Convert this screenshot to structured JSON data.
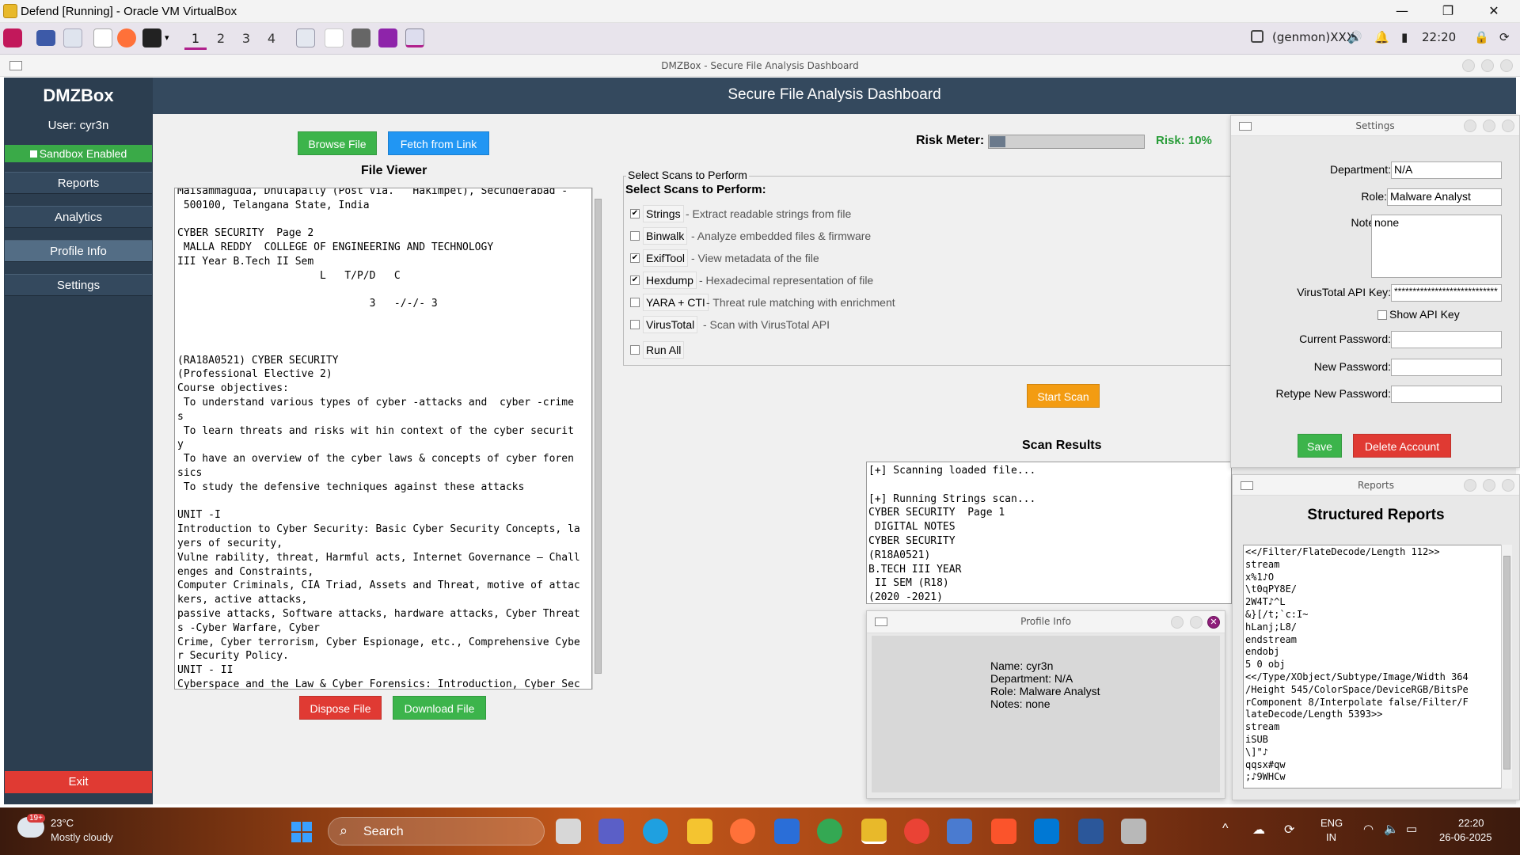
{
  "host": {
    "title": "Defend [Running] - Oracle VM VirtualBox",
    "controls": [
      "—",
      "❐",
      "✕"
    ]
  },
  "panel": {
    "workspaces": [
      "1",
      "2",
      "3",
      "4"
    ],
    "genmon": "(genmon)XXX",
    "clock": "22:20"
  },
  "app": {
    "window_title": "DMZBox - Secure File Analysis Dashboard",
    "sidebar": {
      "brand": "DMZBox",
      "user": "User: cyr3n",
      "sandbox": "Sandbox Enabled",
      "items": [
        {
          "label": "Reports"
        },
        {
          "label": "Analytics"
        },
        {
          "label": "Profile Info"
        },
        {
          "label": "Settings"
        }
      ],
      "exit": "Exit"
    },
    "header_title": "Secure File Analysis Dashboard",
    "toolbar": {
      "browse": "Browse File",
      "fetch": "Fetch from Link",
      "risk_label": "Risk Meter:",
      "risk_value": "Risk: 10%",
      "risk_fraction": 0.1
    },
    "file_viewer": {
      "title": "File Viewer",
      "content": "Maisammaguda, Dhulapally (Post Via.   Hakimpet), Secunderabad -\n 500100, Telangana State, India\n\nCYBER SECURITY  Page 2\n MALLA REDDY  COLLEGE OF ENGINEERING AND TECHNOLOGY\nIII Year B.Tech II Sem\n                       L   T/P/D   C\n\n                               3   -/-/- 3\n\n\n\n(RA18A0521) CYBER SECURITY\n(Professional Elective 2)\nCourse objectives:\n To understand various types of cyber -attacks and  cyber -crime\ns\n To learn threats and risks wit hin context of the cyber securit\ny\n To have an overview of the cyber laws & concepts of cyber foren\nsics\n To study the defensive techniques against these attacks\n\nUNIT -I\nIntroduction to Cyber Security: Basic Cyber Security Concepts, la\nyers of security,\nVulne rability, threat, Harmful acts, Internet Governance – Chall\nenges and Constraints,\nComputer Criminals, CIA Triad, Assets and Threat, motive of attac\nkers, active attacks,\npassive attacks, Software attacks, hardware attacks, Cyber Threat\ns -Cyber Warfare, Cyber\nCrime, Cyber terrorism, Cyber Espionage, etc., Comprehensive Cybe\nr Security Policy.\nUNIT - II\nCyberspace and the Law & Cyber Forensics: Introduction, Cyber Sec",
      "dispose": "Dispose File",
      "download": "Download File"
    },
    "scans": {
      "group_title": "Select Scans to Perform",
      "heading": "Select Scans to Perform:",
      "items": [
        {
          "label": "Strings",
          "desc": "- Extract readable strings from file",
          "checked": "✔"
        },
        {
          "label": "Binwalk",
          "desc": "- Analyze embedded files & firmware",
          "checked": ""
        },
        {
          "label": "ExifTool",
          "desc": "- View metadata of the file",
          "checked": "✔"
        },
        {
          "label": "Hexdump",
          "desc": "- Hexadecimal representation of file",
          "checked": "✔"
        },
        {
          "label": "YARA + CTI",
          "desc": "- Threat rule matching with enrichment",
          "checked": ""
        },
        {
          "label": "VirusTotal",
          "desc": "- Scan with VirusTotal API",
          "checked": ""
        },
        {
          "label": "Run All",
          "desc": "",
          "checked": ""
        }
      ],
      "start": "Start Scan"
    },
    "results": {
      "title": "Scan Results",
      "content": "[+] Scanning loaded file...\n\n[+] Running Strings scan...\nCYBER SECURITY  Page 1\n DIGITAL NOTES\nCYBER SECURITY\n(R18A0521)\nB.TECH III YEAR\n II SEM (R18)\n(2020 -2021)"
    },
    "settings": {
      "window_title": "Settings",
      "department_label": "Department:",
      "department": "N/A",
      "role_label": "Role:",
      "role": "Malware Analyst",
      "notes_label": "Notes:",
      "notes": "none",
      "api_label": "VirusTotal API Key:",
      "api_key": "****************************",
      "show_api": "Show API Key",
      "current_pw": "Current Password:",
      "new_pw": "New Password:",
      "retype_pw": "Retype New Password:",
      "save": "Save",
      "delete": "Delete Account"
    },
    "reports": {
      "window_title": "Reports",
      "heading": "Structured Reports",
      "content": "<</Filter/FlateDecode/Length 112>>\nstream\nx%1♪O\n\\t0qPY8E/\n2W4T♪^L\n&}[/t;`c:I~\nhLanj;L8/\nendstream\nendobj\n5 0 obj\n<</Type/XObject/Subtype/Image/Width 364\n/Height 545/ColorSpace/DeviceRGB/BitsPe\nrComponent 8/Interpolate false/Filter/F\nlateDecode/Length 5393>>\nstream\niSUB\n\\]\"♪\nqqsx#qw\n;♪9WHCw"
    },
    "profile": {
      "window_title": "Profile Info",
      "name": "Name: cyr3n",
      "department": "Department: N/A",
      "role": "Role: Malware Analyst",
      "notes": "Notes: none"
    }
  },
  "taskbar": {
    "weather_temp": "23°C",
    "weather_desc": "Mostly cloudy",
    "weather_badge": "19+",
    "search": "Search",
    "lang_top": "ENG",
    "lang_bottom": "IN",
    "time": "22:20",
    "date": "26-06-2025"
  }
}
